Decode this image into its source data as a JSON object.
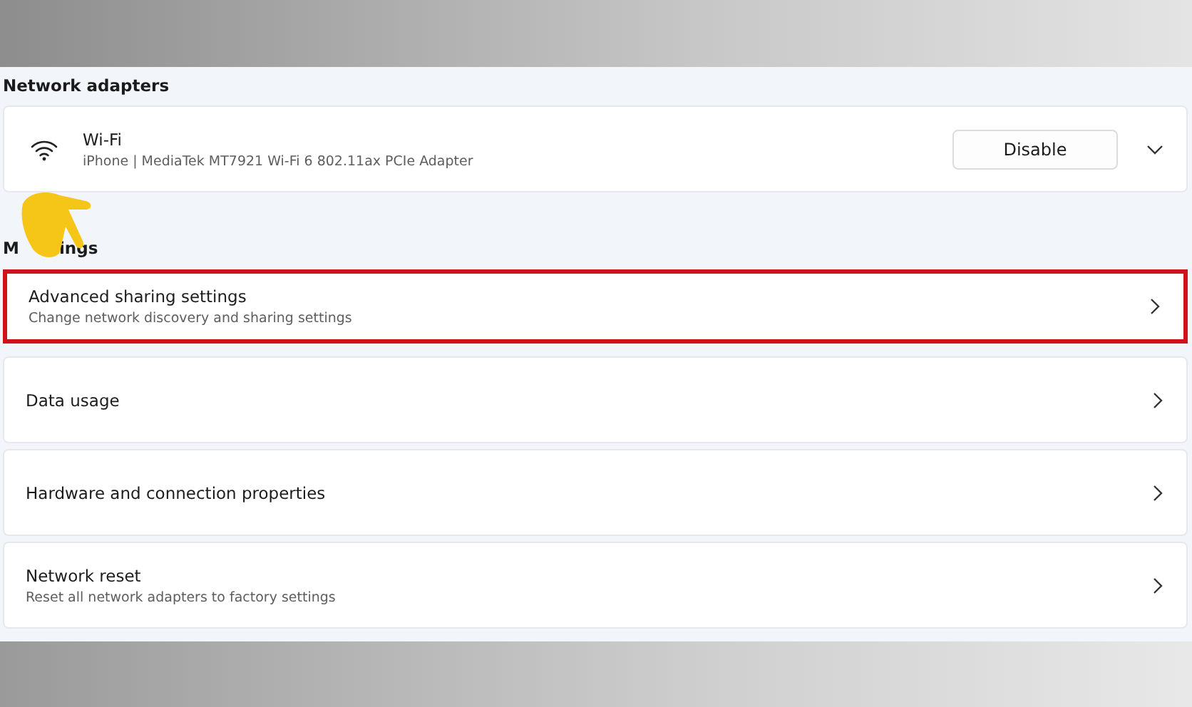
{
  "network_adapters": {
    "heading": "Network adapters",
    "adapters": [
      {
        "name": "Wi-Fi",
        "description": "iPhone | MediaTek MT7921 Wi-Fi 6 802.11ax PCIe Adapter",
        "button": "Disable",
        "expanded": false
      }
    ]
  },
  "more_settings": {
    "heading_parts": [
      "M",
      "ings"
    ],
    "items": [
      {
        "title": "Advanced sharing settings",
        "description": "Change network discovery and sharing settings",
        "highlighted": true
      },
      {
        "title": "Data usage",
        "highlighted": false
      },
      {
        "title": "Hardware and connection properties",
        "highlighted": false
      },
      {
        "title": "Network reset",
        "description": "Reset all network adapters to factory settings",
        "highlighted": false
      }
    ]
  }
}
